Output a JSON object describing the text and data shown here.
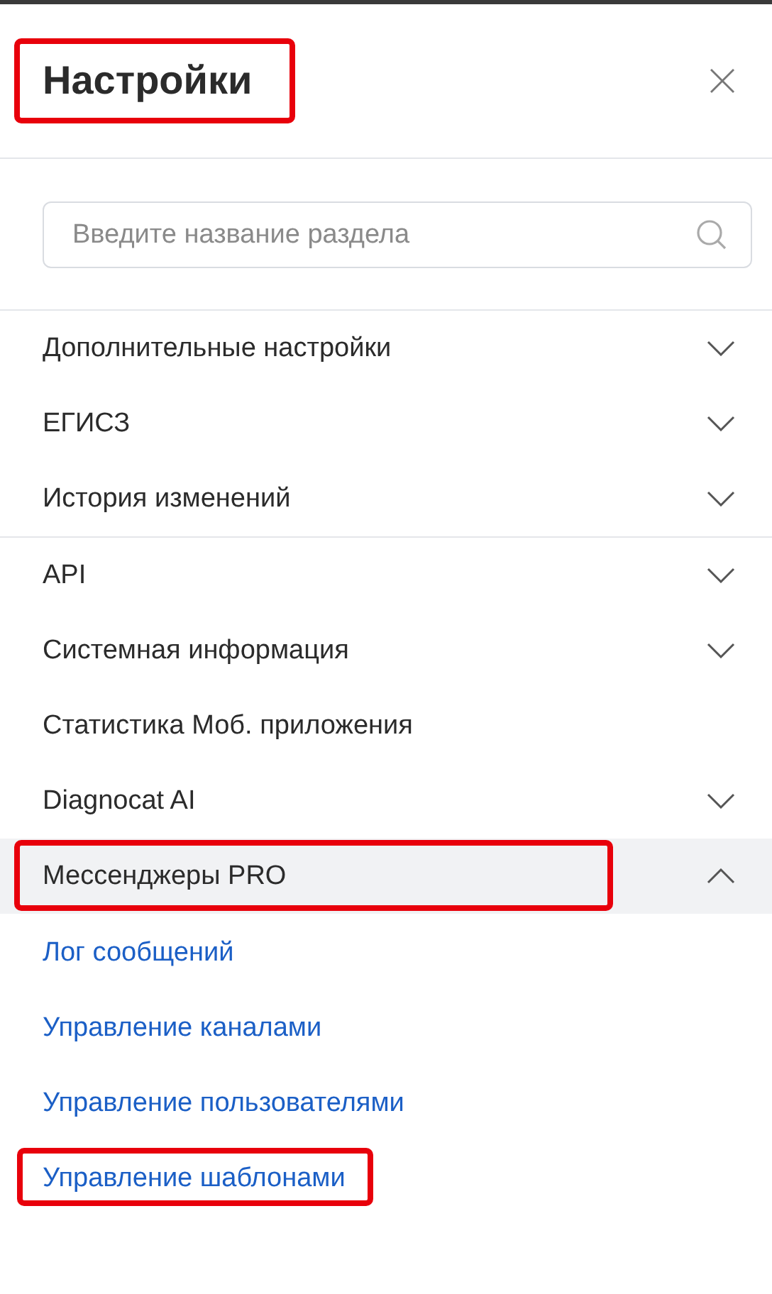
{
  "panel": {
    "title": "Настройки",
    "title_highlighted": true
  },
  "search": {
    "placeholder": "Введите название раздела"
  },
  "groups": [
    [
      {
        "label": "Дополнительные настройки",
        "expandable": true,
        "expanded": false,
        "highlighted": false
      },
      {
        "label": "ЕГИСЗ",
        "expandable": true,
        "expanded": false,
        "highlighted": false
      },
      {
        "label": "История изменений",
        "expandable": true,
        "expanded": false,
        "highlighted": false
      }
    ],
    [
      {
        "label": "API",
        "expandable": true,
        "expanded": false,
        "highlighted": false
      },
      {
        "label": "Системная информация",
        "expandable": true,
        "expanded": false,
        "highlighted": false
      },
      {
        "label": "Статистика Моб. приложения",
        "expandable": false,
        "expanded": false,
        "highlighted": false
      },
      {
        "label": "Diagnocat AI",
        "expandable": true,
        "expanded": false,
        "highlighted": false
      },
      {
        "label": "Мессенджеры PRO",
        "expandable": true,
        "expanded": true,
        "highlighted": true,
        "children": [
          {
            "label": "Лог сообщений",
            "highlighted": false
          },
          {
            "label": "Управление каналами",
            "highlighted": false
          },
          {
            "label": "Управление пользователями",
            "highlighted": false
          },
          {
            "label": "Управление шаблонами",
            "highlighted": true
          }
        ]
      }
    ]
  ]
}
